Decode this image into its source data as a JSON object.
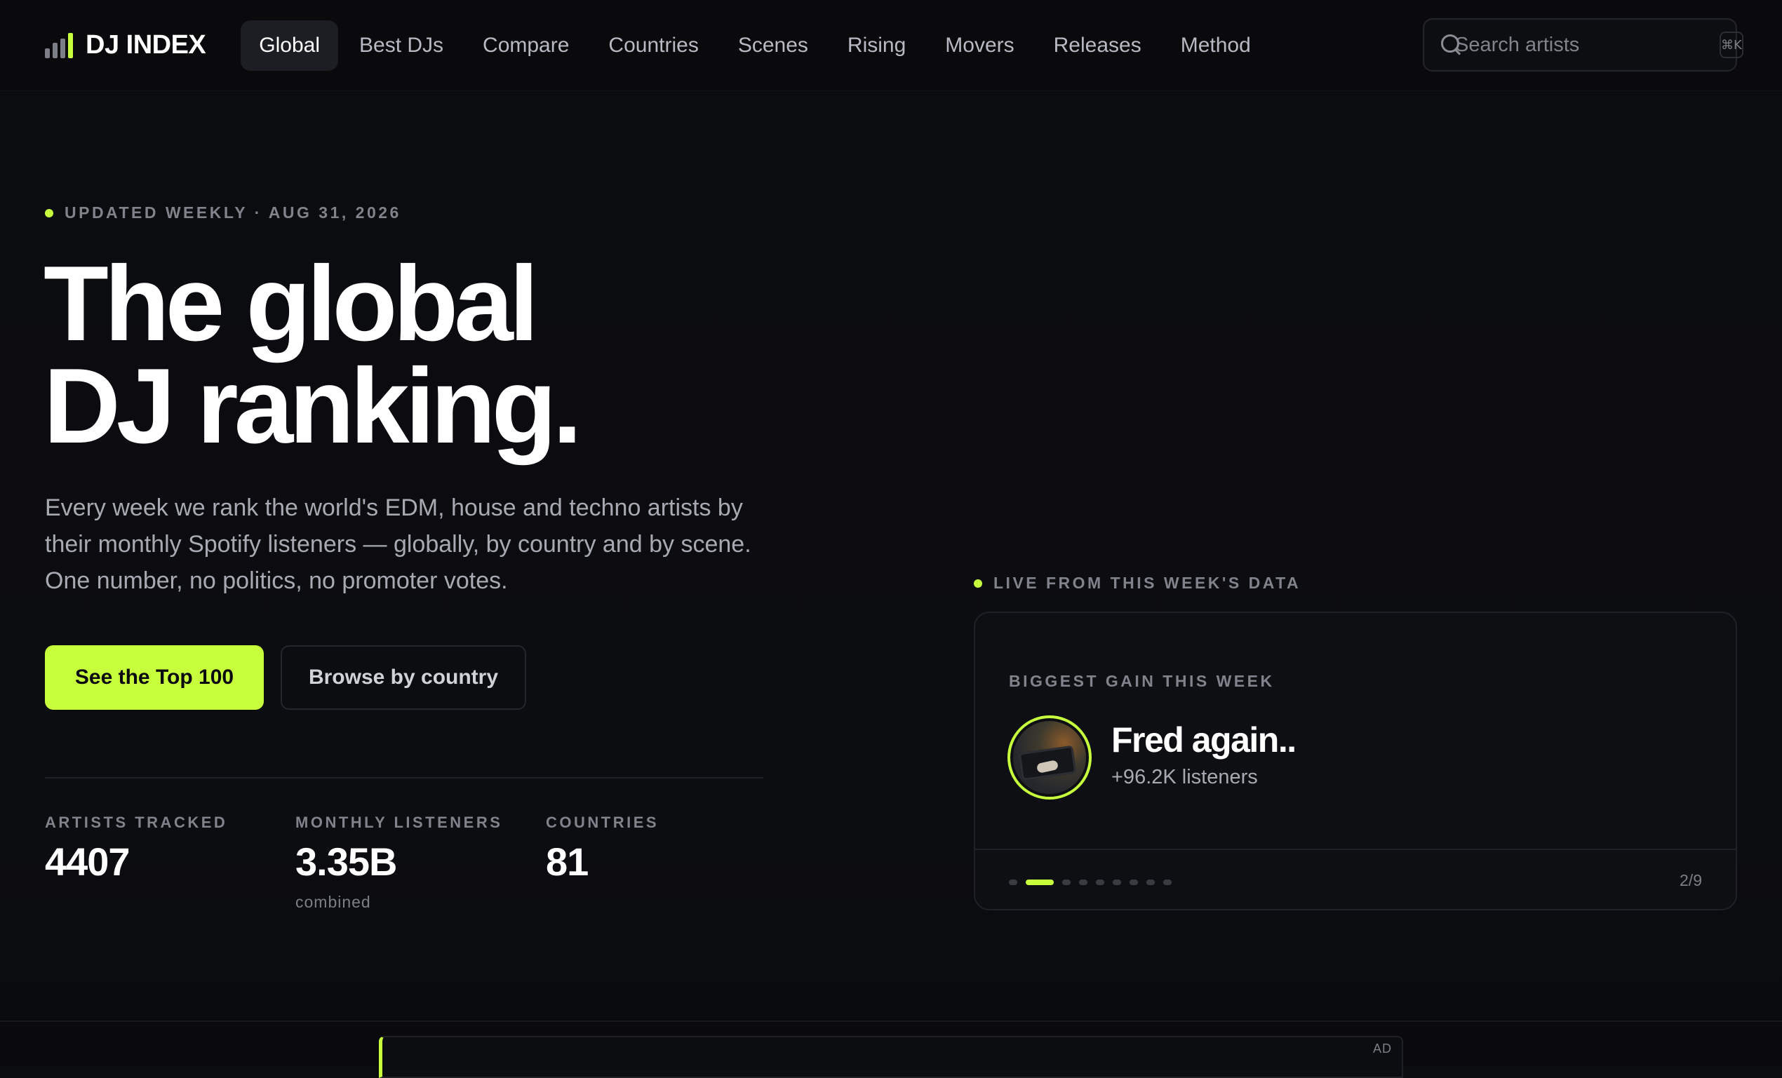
{
  "brand": {
    "name": "DJ INDEX"
  },
  "nav": {
    "items": [
      {
        "label": "Global",
        "active": true
      },
      {
        "label": "Best DJs",
        "active": false
      },
      {
        "label": "Compare",
        "active": false
      },
      {
        "label": "Countries",
        "active": false
      },
      {
        "label": "Scenes",
        "active": false
      },
      {
        "label": "Rising",
        "active": false
      },
      {
        "label": "Movers",
        "active": false
      },
      {
        "label": "Releases",
        "active": false
      },
      {
        "label": "Method",
        "active": false
      }
    ]
  },
  "search": {
    "placeholder": "Search artists",
    "shortcut": "⌘K"
  },
  "hero": {
    "updated": "UPDATED WEEKLY · AUG 31, 2026",
    "headline_line1": "The global",
    "headline_line2": "DJ ranking.",
    "lead": "Every week we rank the world's EDM, house and techno artists by their monthly Spotify listeners — globally, by country and by scene. One number, no politics, no promoter votes.",
    "primary_cta": "See the Top 100",
    "secondary_cta": "Browse by country"
  },
  "stats": [
    {
      "label": "ARTISTS TRACKED",
      "value": "4407",
      "sub": ""
    },
    {
      "label": "MONTHLY LISTENERS",
      "value": "3.35B",
      "sub": "combined"
    },
    {
      "label": "COUNTRIES",
      "value": "81",
      "sub": ""
    }
  ],
  "live": {
    "label": "LIVE FROM THIS WEEK'S DATA",
    "card_label": "BIGGEST GAIN THIS WEEK",
    "artist_name": "Fred again..",
    "artist_sub": "+96.2K listeners",
    "page_current": 2,
    "page_total": 9,
    "page_count": "2/9"
  },
  "ad": {
    "label": "AD"
  },
  "colors": {
    "accent": "#c8ff3d",
    "background": "#0b0c0f",
    "muted": "#80838c"
  }
}
